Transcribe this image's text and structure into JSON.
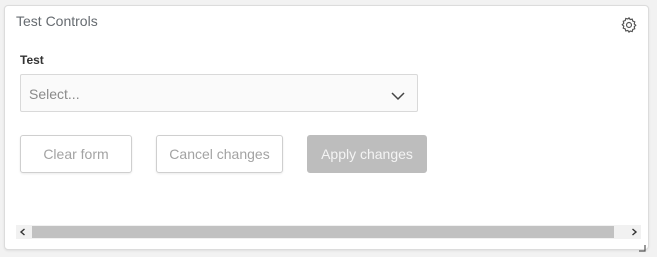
{
  "panel": {
    "title": "Test Controls",
    "settings_icon": "gear-icon"
  },
  "form": {
    "field_label": "Test",
    "select_placeholder": "Select..."
  },
  "buttons": {
    "clear_label": "Clear form",
    "cancel_label": "Cancel changes",
    "apply_label": "Apply changes"
  },
  "scrollbar": {
    "left_arrow": "<",
    "right_arrow": ">"
  },
  "colors": {
    "apply_disabled_bg": "#bdbdbd",
    "panel_border": "#dcdcdc"
  }
}
